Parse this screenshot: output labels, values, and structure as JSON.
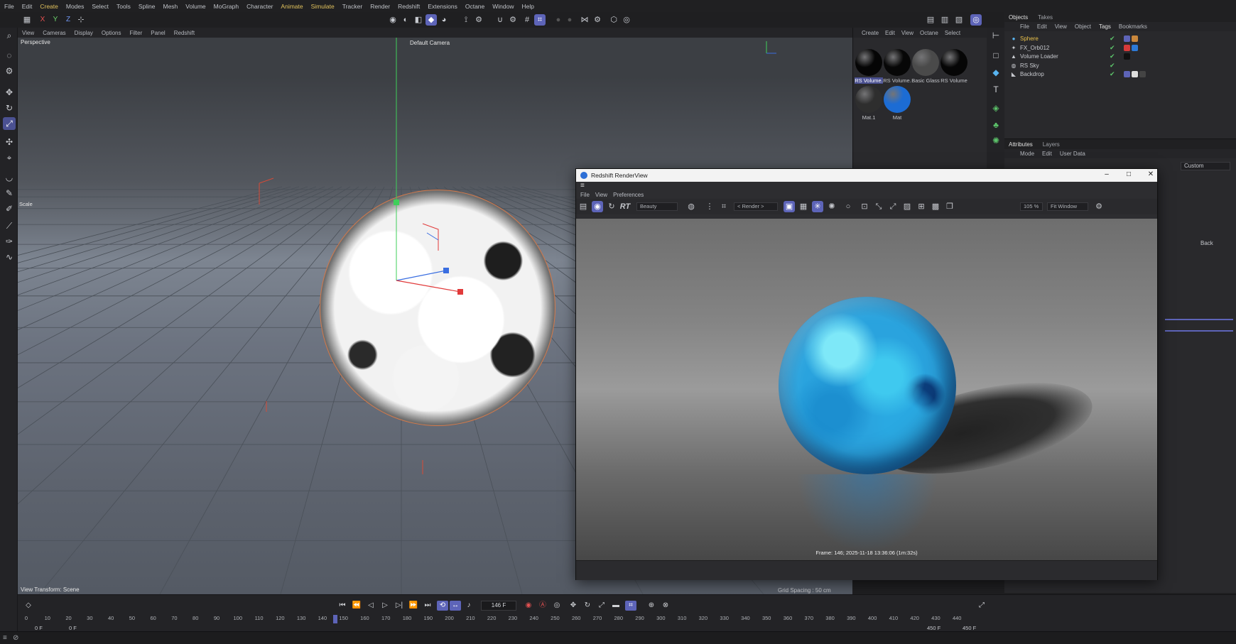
{
  "menubar": [
    "File",
    "Edit",
    "Create",
    "Modes",
    "Select",
    "Tools",
    "Spline",
    "Mesh",
    "Volume",
    "MoGraph",
    "Character",
    "Animate",
    "Simulate",
    "Tracker",
    "Render",
    "Redshift",
    "Extensions",
    "Octane",
    "Window",
    "Help"
  ],
  "menubar_highlight": [
    "Create",
    "Animate",
    "Simulate"
  ],
  "axis": {
    "x": "X",
    "y": "Y",
    "z": "Z"
  },
  "viewport": {
    "menu": [
      "View",
      "Cameras",
      "Display",
      "Options",
      "Filter",
      "Panel",
      "Redshift"
    ],
    "label": "Perspective",
    "camera": "Default Camera",
    "transform": "View Transform: Scene",
    "grid_spacing": "Grid Spacing : 50 cm",
    "scale_tool": "Scale"
  },
  "material_manager": {
    "menu": [
      "Create",
      "Edit",
      "View",
      "Octane",
      "Select"
    ],
    "materials": [
      {
        "label": "RS Volume.",
        "color": "#050505",
        "selected": true
      },
      {
        "label": "RS Volume.",
        "color": "#070707",
        "selected": false
      },
      {
        "label": "Basic Glass",
        "color": "#4a4a4a",
        "selected": false
      },
      {
        "label": "RS Volume",
        "color": "#060606",
        "selected": false
      },
      {
        "label": "Mat.1",
        "color": "#2e2e2e",
        "selected": false
      },
      {
        "label": "Mat",
        "color": "#1c6cd4",
        "selected": false
      }
    ]
  },
  "objects": {
    "tabs": [
      "Objects",
      "Takes"
    ],
    "menu": [
      "File",
      "Edit",
      "View",
      "Object",
      "Tags",
      "Bookmarks"
    ],
    "rows": [
      {
        "name": "Sphere",
        "icon": "sphere-icon",
        "selected": true
      },
      {
        "name": "FX_Orb012",
        "icon": "fx-icon",
        "selected": false
      },
      {
        "name": "Volume Loader",
        "icon": "volume-icon",
        "selected": false
      },
      {
        "name": "RS Sky",
        "icon": "sky-icon",
        "selected": false
      },
      {
        "name": "Backdrop",
        "icon": "backdrop-icon",
        "selected": false
      }
    ]
  },
  "attributes": {
    "tabs": [
      "Attributes",
      "Layers"
    ],
    "menu": [
      "Mode",
      "Edit",
      "User Data"
    ],
    "dropdown": "Custom",
    "back_label": "Back"
  },
  "renderview": {
    "title": "Redshift RenderView",
    "menu": [
      "File",
      "View",
      "Preferences"
    ],
    "aov": "Beauty",
    "render_dropdown": "< Render >",
    "zoom": "105 %",
    "fit": "Fit Window",
    "caption": "Frame: 146;  2025-11-18  13:36:06  (1m:32s)"
  },
  "timeline": {
    "current_frame": "146 F",
    "ticks": [
      0,
      10,
      20,
      30,
      40,
      50,
      60,
      70,
      80,
      90,
      100,
      110,
      120,
      130,
      140,
      150,
      160,
      170,
      180,
      190,
      200,
      210,
      220,
      230,
      240,
      250,
      260,
      270,
      280,
      290,
      300,
      310,
      320,
      330,
      340,
      350,
      360,
      370,
      380,
      390,
      400,
      410,
      420,
      430,
      440
    ],
    "playhead": 146,
    "range_start": "0 F",
    "range_start2": "0 F",
    "range_end": "450 F",
    "range_end2": "450 F"
  },
  "colors": {
    "accent": "#5d64b8",
    "selection": "#e8c04b",
    "x_axis": "#e13a3a",
    "y_axis": "#3fcf5a",
    "z_axis": "#3a6ee1"
  }
}
